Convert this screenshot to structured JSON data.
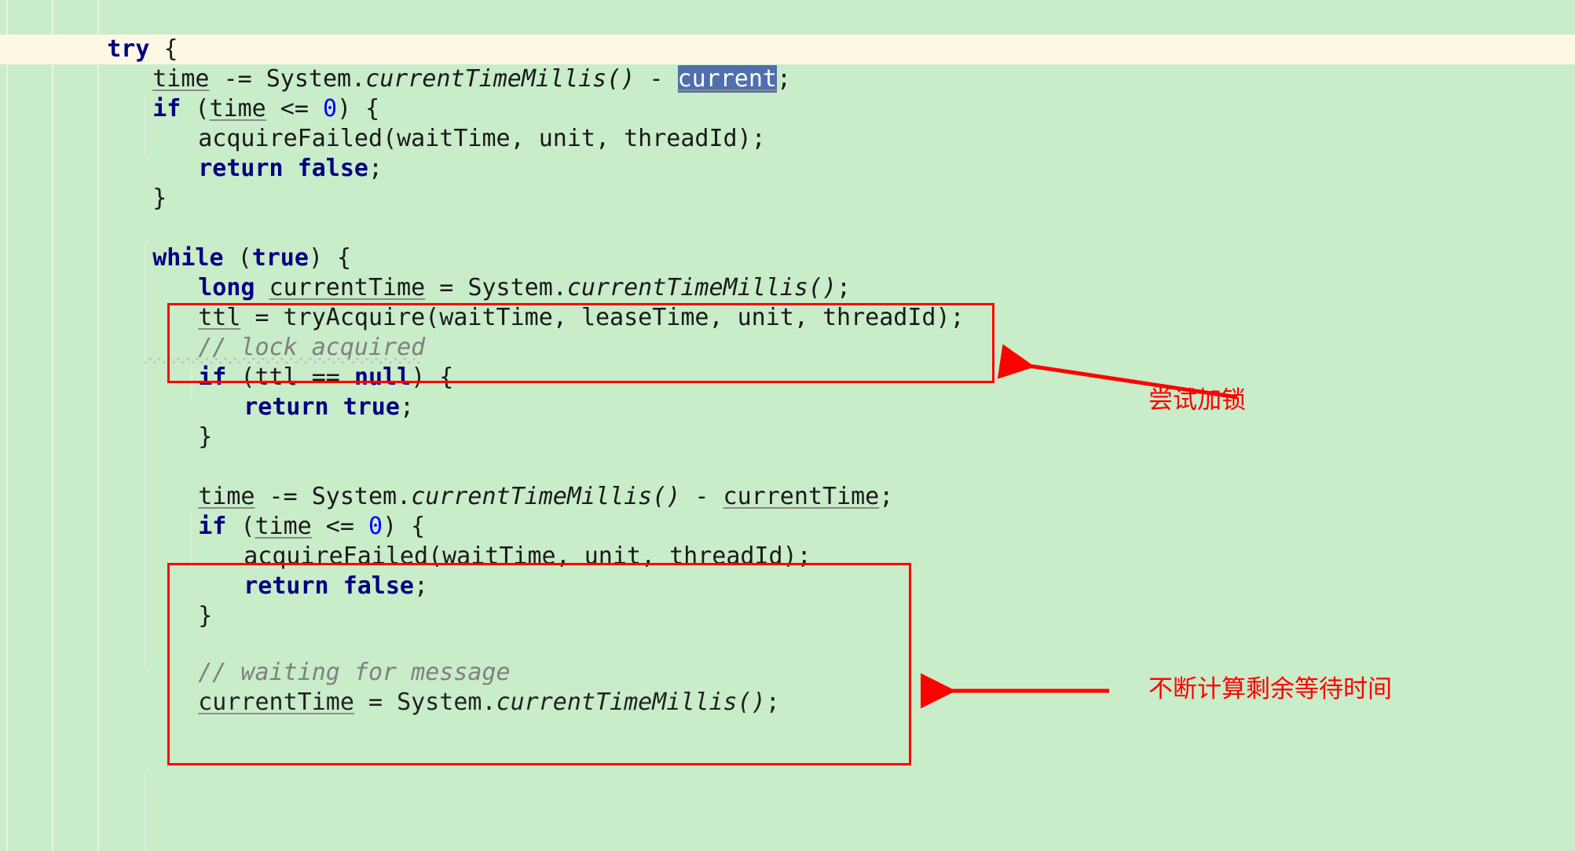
{
  "editor": {
    "theme_colors": {
      "background": "#c9ecc9",
      "caret_line": "#fdf8e4",
      "keyword": "#000080",
      "number": "#0000ff",
      "comment": "#808080",
      "selection_bg": "#4f6fad",
      "selection_fg": "#ffffff",
      "annotation_red": "#ff0000",
      "indent_guide": "#e7f3e7"
    },
    "lines": [
      {
        "id": "line-try",
        "indent": 2,
        "text": "try {"
      },
      {
        "id": "line-time-minus",
        "indent": 3,
        "text": "time -= System.currentTimeMillis() - current;"
      },
      {
        "id": "line-if-time",
        "indent": 3,
        "text": "if (time <= 0) {"
      },
      {
        "id": "line-acquirefailed-1",
        "indent": 4,
        "text": "acquireFailed(waitTime, unit, threadId);"
      },
      {
        "id": "line-return-false-1",
        "indent": 4,
        "text": "return false;"
      },
      {
        "id": "line-close-brace-1",
        "indent": 3,
        "text": "}"
      },
      {
        "id": "line-blank-1",
        "indent": 0,
        "text": ""
      },
      {
        "id": "line-while-true",
        "indent": 3,
        "text": "while (true) {"
      },
      {
        "id": "line-long-currenttime",
        "indent": 4,
        "text": "long currentTime = System.currentTimeMillis();"
      },
      {
        "id": "line-ttl-tryacquire",
        "indent": 4,
        "text": "ttl = tryAcquire(waitTime, leaseTime, unit, threadId);"
      },
      {
        "id": "line-comment-lock",
        "indent": 4,
        "text": "// lock acquired"
      },
      {
        "id": "line-if-ttl-null",
        "indent": 4,
        "text": "if (ttl == null) {"
      },
      {
        "id": "line-return-true",
        "indent": 5,
        "text": "return true;"
      },
      {
        "id": "line-close-brace-2",
        "indent": 4,
        "text": "}"
      },
      {
        "id": "line-blank-2",
        "indent": 0,
        "text": ""
      },
      {
        "id": "line-time-minus-2",
        "indent": 4,
        "text": "time -= System.currentTimeMillis() - currentTime;"
      },
      {
        "id": "line-if-time-2",
        "indent": 4,
        "text": "if (time <= 0) {"
      },
      {
        "id": "line-acquirefailed-2",
        "indent": 5,
        "text": "acquireFailed(waitTime, unit, threadId);"
      },
      {
        "id": "line-return-false-2",
        "indent": 5,
        "text": "return false;"
      },
      {
        "id": "line-close-brace-3",
        "indent": 4,
        "text": "}"
      },
      {
        "id": "line-blank-3",
        "indent": 0,
        "text": ""
      },
      {
        "id": "line-comment-waiting",
        "indent": 4,
        "text": "// waiting for message"
      },
      {
        "id": "line-currenttime-2",
        "indent": 4,
        "text": "currentTime = System.currentTimeMillis();"
      }
    ],
    "selection": {
      "text": "current",
      "line": "line-time-minus"
    }
  },
  "annotations": [
    {
      "id": "annotation-try-lock",
      "label": "尝试加锁",
      "target": "ttl = tryAcquire(...)"
    },
    {
      "id": "annotation-remaining",
      "label": "不断计算剩余等待时间",
      "target": "time -= System.currentTimeMillis() - currentTime"
    }
  ],
  "code_tokens": {
    "try": "try",
    "if": "if",
    "while": "while",
    "long": "long",
    "return": "return",
    "true": "true",
    "false": "false",
    "null": "null",
    "zero": "0",
    "time": "time",
    "ttl": "ttl",
    "current": "current",
    "currentTime": "currentTime",
    "system": "System.",
    "currentTimeMillis": "currentTimeMillis()",
    "tryAcquire": "tryAcquire",
    "acquireFailed": "acquireFailed",
    "waitTime": "waitTime",
    "leaseTime": "leaseTime",
    "unit": "unit",
    "threadId": "threadId",
    "comment_lock_acquired": "// lock acquired",
    "comment_waiting_for_message": "// waiting for message"
  }
}
